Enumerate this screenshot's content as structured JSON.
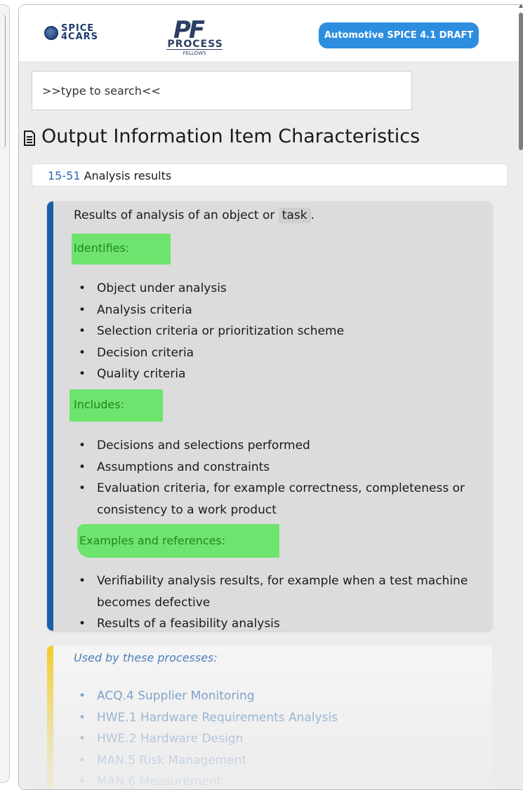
{
  "header": {
    "logo_spice_line1": "SPICE",
    "logo_spice_line2": "4CARS",
    "logo_pf_mark": "PF",
    "logo_pf_name": "PROCESS",
    "logo_pf_sub": "FELLOWS",
    "version_badge": "Automotive SPICE 4.1 DRAFT"
  },
  "search": {
    "placeholder": ">>type to search<<"
  },
  "page": {
    "title": "Output Information Item Characteristics"
  },
  "item": {
    "id": "15-51",
    "name": "Analysis results"
  },
  "description": {
    "text_before": "Results of analysis of an object or ",
    "code": "task",
    "text_after": ".",
    "sections": [
      {
        "heading": "Identifies:",
        "items": [
          "Object under analysis",
          "Analysis criteria",
          "Selection criteria or prioritization scheme",
          "Decision criteria",
          "Quality criteria"
        ]
      },
      {
        "heading": "Includes:",
        "items": [
          "Decisions and selections performed",
          "Assumptions and constraints",
          "Evaluation criteria, for example correctness, completeness or consistency to a work product"
        ]
      },
      {
        "heading": "Examples and references:",
        "items": [
          "Verifiability analysis results, for example when a test machine becomes defective",
          "Results of a feasibility analysis"
        ]
      }
    ]
  },
  "processes": {
    "heading": "Used by these processes:",
    "items": [
      "ACQ.4 Supplier Monitoring",
      "HWE.1 Hardware Requirements Analysis",
      "HWE.2 Hardware Design",
      "MAN.5 Risk Management",
      "MAN.6 Measurement"
    ]
  },
  "colors": {
    "badge": "#2d8ee0",
    "description_accent": "#1b5fa8",
    "process_accent": "#f2cb1a",
    "highlight": "#6ee36e",
    "link": "#2a6ab0"
  },
  "icons": {
    "title_icon": "document-icon",
    "logo_icon": "globe-icon"
  }
}
